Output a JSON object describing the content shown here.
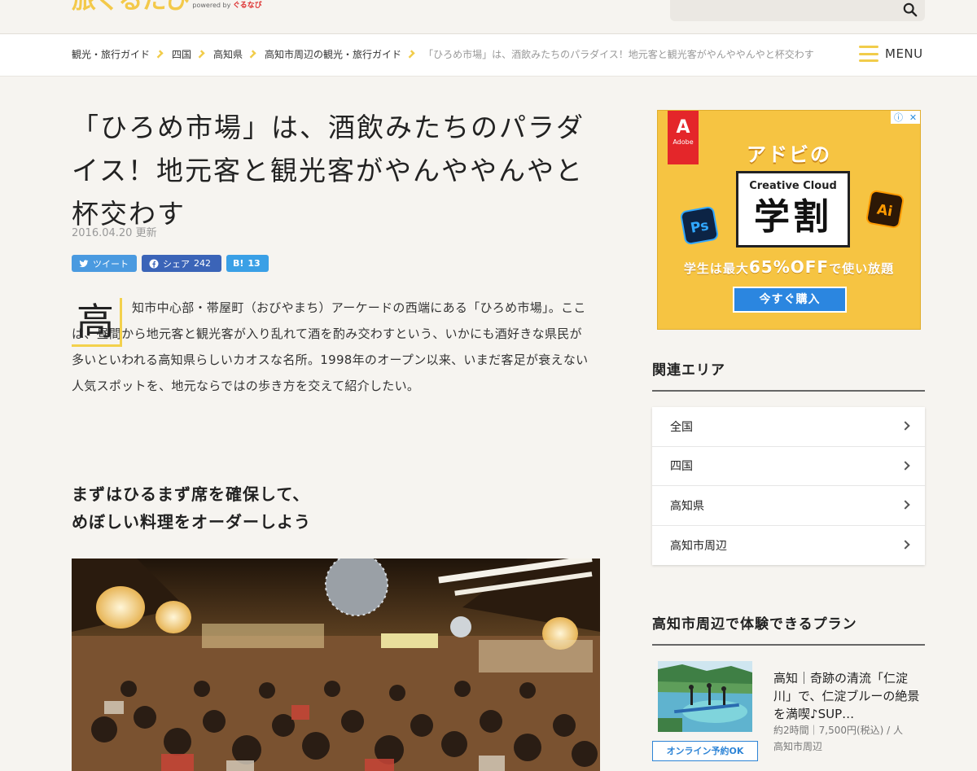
{
  "header": {
    "logo_text": "旅ぐるたび",
    "logo_powered": "powered by",
    "logo_brand": "ぐるなび"
  },
  "breadcrumb": {
    "items": [
      "観光・旅行ガイド",
      "四国",
      "高知県",
      "高知市周辺の観光・旅行ガイド"
    ],
    "current": "「ひろめ市場」は、酒飲みたちのパラダイス！地元客と観光客がやんややんやと杯交わす"
  },
  "menu": {
    "label": "MENU"
  },
  "article": {
    "title": "「ひろめ市場」は、酒飲みたちのパラダイス！地元客と観光客がやんややんやと杯交わす",
    "date": "2016.04.20 更新",
    "share": {
      "tweet_label": "ツイート",
      "fb_label": "シェア",
      "fb_count": "242",
      "hatena_label": "B!",
      "hatena_count": "13"
    },
    "dropcap": "高",
    "lead": "知市中心部・帯屋町（おびやまち）アーケードの西端にある「ひろめ市場」。ここは、昼間から地元客と観光客が入り乱れて酒を酌み交わすという、いかにも酒好きな県民が多いといわれる高知県らしいカオスな名所。1998年のオープン以来、いまだ客足が衰えない人気スポットを、地元ならではの歩き方を交えて紹介したい。",
    "heading_line1": "まずはひるまず席を確保して、",
    "heading_line2": "めぼしい料理をオーダーしよう"
  },
  "ad": {
    "brand": "Adobe",
    "title": "アドビの",
    "box_sub": "Creative Cloud",
    "box_main": "学割",
    "ps": "Ps",
    "ai": "Ai",
    "copy_prefix": "学生は最大",
    "copy_percent": "65%OFF",
    "copy_suffix": "で使い放題",
    "button": "今すぐ購入"
  },
  "related_area": {
    "heading": "関連エリア",
    "items": [
      "全国",
      "四国",
      "高知県",
      "高知市周辺"
    ]
  },
  "plans": {
    "heading": "高知市周辺で体験できるプラン",
    "item": {
      "title": "高知｜奇跡の清流「仁淀川」で、仁淀ブルーの絶景を満喫♪SUP…",
      "meta_line1": "約2時間｜7,500円(税込) / 人",
      "meta_line2": "高知市周辺",
      "badge": "オンライン予約OK"
    }
  },
  "colors": {
    "accent": "#f1cc4a",
    "background": "#f6f4f0",
    "twitter": "#4a9ae0",
    "facebook": "#3b64b8",
    "hatena": "#3aa0e6"
  }
}
